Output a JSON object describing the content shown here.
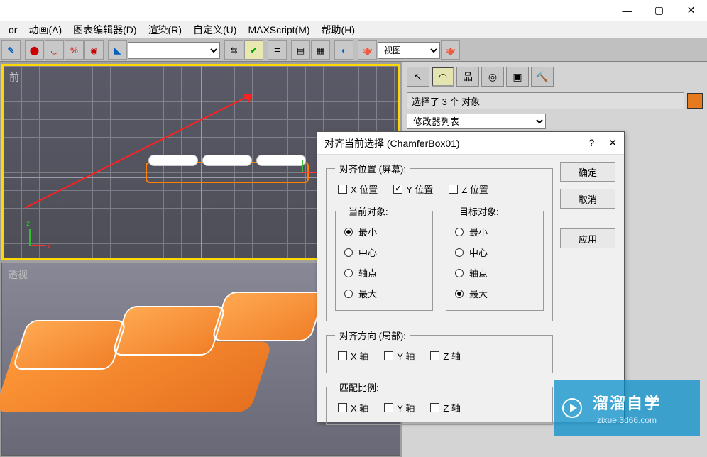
{
  "window": {
    "minimize": "—",
    "maximize": "▢",
    "close": "✕"
  },
  "menubar": {
    "items": [
      "or",
      "动画(A)",
      "图表编辑器(D)",
      "渲染(R)",
      "自定义(U)",
      "MAXScript(M)",
      "帮助(H)"
    ]
  },
  "toolbar": {
    "nameselect_value": "",
    "view_label": "视图"
  },
  "sidepanel": {
    "selection_info": "选择了 3 个 对象",
    "modifier_list": "修改器列表",
    "swatch_color": "#e67a1f"
  },
  "viewports": {
    "front_label": "前",
    "persp_label": "透视",
    "axis_x": "x",
    "axis_y": "z"
  },
  "dialog": {
    "title": "对齐当前选择 (ChamferBox01)",
    "help": "?",
    "close": "✕",
    "buttons": {
      "ok": "确定",
      "cancel": "取消",
      "apply": "应用"
    },
    "align_position": {
      "legend": "对齐位置 (屏幕):",
      "x": "X 位置",
      "x_checked": false,
      "y": "Y 位置",
      "y_checked": true,
      "z": "Z 位置",
      "z_checked": false,
      "current": {
        "legend": "当前对象:",
        "min": "最小",
        "center": "中心",
        "pivot": "轴点",
        "max": "最大",
        "selected": "min"
      },
      "target": {
        "legend": "目标对象:",
        "min": "最小",
        "center": "中心",
        "pivot": "轴点",
        "max": "最大",
        "selected": "max"
      }
    },
    "align_orientation": {
      "legend": "对齐方向 (局部):",
      "x": "X 轴",
      "y": "Y 轴",
      "z": "Z 轴"
    },
    "match_scale": {
      "legend": "匹配比例:",
      "x": "X 轴",
      "y": "Y 轴",
      "z": "Z 轴"
    }
  },
  "watermark": {
    "text": "溜溜自学",
    "url": "zixue.3d66.com"
  }
}
